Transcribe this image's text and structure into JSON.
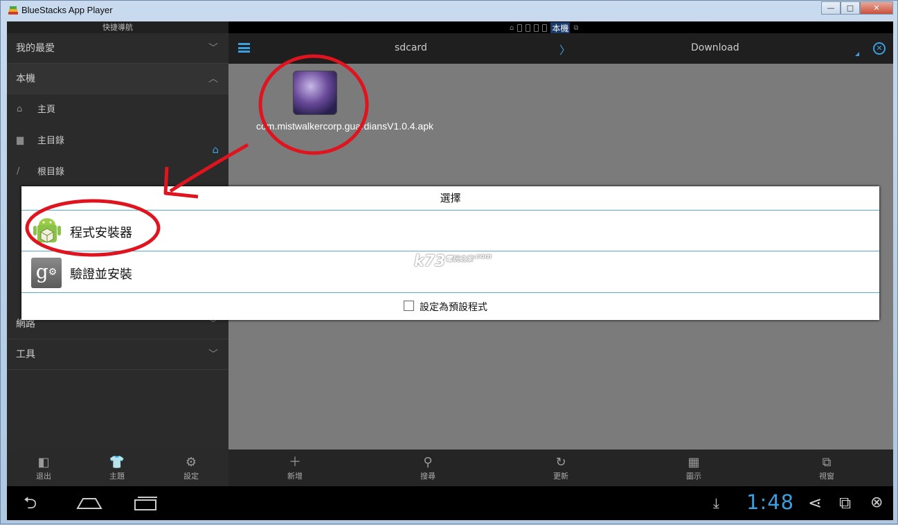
{
  "window": {
    "title": "BlueStacks App Player",
    "btn_min": "—",
    "btn_max": "□",
    "btn_close": "✕"
  },
  "statusbar": {
    "local_label": "本機"
  },
  "drawer": {
    "header": "快捷導航",
    "sections": [
      {
        "label": "我的最愛",
        "expanded": false
      },
      {
        "label": "本機",
        "expanded": true
      }
    ],
    "sub_items": [
      {
        "label": "主頁",
        "icon": "home-icon"
      },
      {
        "label": "主目錄",
        "icon": "folder-icon"
      },
      {
        "label": "根目錄",
        "icon": "slash-icon"
      }
    ],
    "lower_sections": [
      {
        "label": "網路"
      },
      {
        "label": "工具"
      }
    ]
  },
  "toolbar": {
    "crumb1": "sdcard",
    "crumb2": "Download"
  },
  "file": {
    "name": "com.mistwalkercorp.guardiansV1.0.4.apk"
  },
  "bottom": {
    "left": [
      {
        "label": "退出",
        "icon": "exit-icon"
      },
      {
        "label": "主題",
        "icon": "shirt-icon"
      },
      {
        "label": "設定",
        "icon": "gear-icon"
      }
    ],
    "right": [
      {
        "label": "新增",
        "icon": "plus-icon"
      },
      {
        "label": "搜尋",
        "icon": "search-icon"
      },
      {
        "label": "更新",
        "icon": "refresh-icon"
      },
      {
        "label": "圖示",
        "icon": "grid-icon"
      },
      {
        "label": "視窗",
        "icon": "window-icon"
      }
    ]
  },
  "nav": {
    "time": "1:48"
  },
  "dialog": {
    "title": "選擇",
    "options": [
      {
        "label": "程式安裝器",
        "icon": "android-installer-icon"
      },
      {
        "label": "驗證並安裝",
        "icon": "google-settings-icon"
      }
    ],
    "default_checkbox": {
      "label": "設定為預設程式",
      "checked": false
    }
  },
  "watermark": {
    "text": "k73",
    "small": "電玩之家",
    "domain": ".com"
  },
  "colors": {
    "accent": "#3aa0e0",
    "annotation": "#e0141e"
  }
}
